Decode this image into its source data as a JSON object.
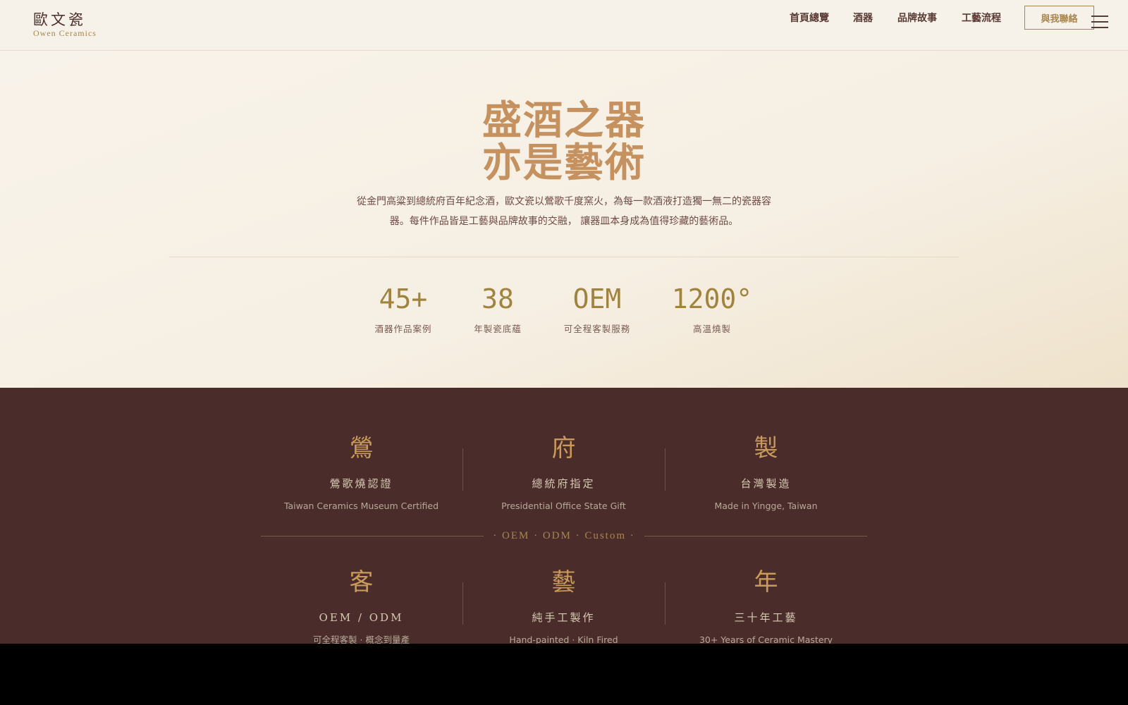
{
  "header": {
    "logo_cn": "歐文瓷",
    "logo_en": "Owen Ceramics",
    "nav": [
      "首頁總覽",
      "酒器",
      "品牌故事",
      "工藝流程"
    ],
    "contact_label": "與我聯絡"
  },
  "hero": {
    "title_line1": "盛酒之器",
    "title_line2": "亦是藝術",
    "desc_line1": "從金門高粱到總統府百年紀念酒，歐文瓷以鶯歌千度窯火，為每一款酒液打造獨一無二的瓷器容",
    "desc_line2": "器。每件作品皆是工藝與品牌故事的交融， 讓器皿本身成為值得珍藏的藝術品。",
    "stats": [
      {
        "value": "45+",
        "label": "酒器作品案例"
      },
      {
        "value": "38",
        "label": "年製瓷底蘊"
      },
      {
        "value": "OEM",
        "label": "可全程客製服務"
      },
      {
        "value": "1200°",
        "label": "高溫燒製"
      }
    ]
  },
  "features_top": [
    {
      "char": "鶯",
      "title": "鶯歌燒認證",
      "sub": "Taiwan Ceramics Museum Certified"
    },
    {
      "char": "府",
      "title": "總統府指定",
      "sub": "Presidential Office State Gift"
    },
    {
      "char": "製",
      "title": "台灣製造",
      "sub": "Made in Yingge, Taiwan"
    }
  ],
  "divider_text": "· OEM · ODM · Custom ·",
  "features_bottom": [
    {
      "char": "客",
      "title": "OEM / ODM",
      "sub": "可全程客製 · 概念到量產"
    },
    {
      "char": "藝",
      "title": "純手工製作",
      "sub": "Hand-painted · Kiln Fired"
    },
    {
      "char": "年",
      "title": "三十年工藝",
      "sub": "30+ Years of Ceramic Mastery"
    }
  ],
  "colors": {
    "cream": "#f7f2e9",
    "brown_dark": "#4a2c2a",
    "gold": "#a7864f",
    "title_tan": "#c4915f"
  }
}
